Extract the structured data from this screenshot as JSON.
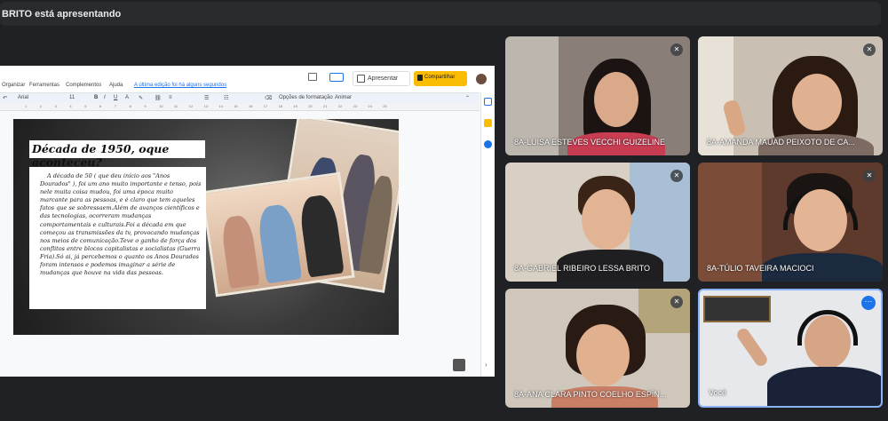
{
  "presenting_banner": "BRITO está apresentando",
  "docs": {
    "menu": [
      "Organizar",
      "Ferramentas",
      "Complementos",
      "Ajuda"
    ],
    "last_edit_link": "A última edição foi há alguns segundos",
    "present_label": "Apresentar",
    "share_label": "Compartilhar",
    "toolbar": {
      "font": "Arial",
      "size": "11",
      "format_options": "Opções de formatação",
      "animate": "Animar"
    },
    "ruler_ticks": [
      "1",
      "2",
      "3",
      "4",
      "5",
      "6",
      "7",
      "8",
      "9",
      "10",
      "11",
      "12",
      "13",
      "14",
      "15",
      "16",
      "17",
      "18",
      "19",
      "20",
      "21",
      "22",
      "23",
      "24",
      "25"
    ]
  },
  "slide": {
    "title": "Década de 1950, oque aconteceu?",
    "body": "A década de 50 ( que deu início aos \"Anos Dourados\" ), foi um ano muito importante e tenso, pois nele muita coisa mudou, foi uma época muito marcante para as pessoas, e é claro que tem aqueles fatos que se sobressaem.Além de avanços científicos e das tecnologias, ocorreram mudanças comportamentais e culturais.Foi a década em que começou as transmissões da tv, provocando mudanças nos meios de comunicação.Teve o ganho de força dos conflitos entre blocos capitalistas e socialistas (Guerra Fria).Só ai, já percebemos o quanto os Anos Dourados foram intensos e podemos imaginar a série de mudanças que houve na vida das pessoas."
  },
  "participants": [
    {
      "name": "8A-LUISA ESTEVES VECCHI GUIZELINE",
      "muted": true
    },
    {
      "name": "8A-AMANDA MAUAD PEIXOTO DE CA...",
      "muted": true
    },
    {
      "name": "8A-GABRIEL RIBEIRO LESSA BRITO",
      "muted": true
    },
    {
      "name": "8A-TÚLIO TAVEIRA MACIOCI",
      "muted": true
    },
    {
      "name": "8A-ANA CLARA PINTO COELHO ESPÍN...",
      "muted": true
    },
    {
      "name": "Você",
      "muted": false
    }
  ],
  "colors": {
    "accent": "#1a73e8",
    "share": "#fbbc04",
    "background": "#202124"
  }
}
